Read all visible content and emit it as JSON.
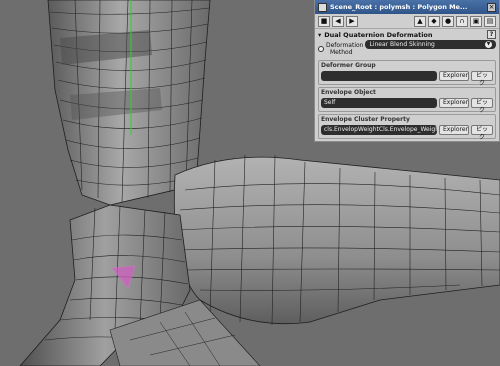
{
  "panel": {
    "title": "Scene_Root : polymsh : Polygon Me...",
    "close_glyph": "×",
    "toolbar": {
      "nav_prev": "◀",
      "nav_next": "▶"
    },
    "section": {
      "title": "Dual Quaternion Deformation",
      "help_label": "?",
      "collapse_glyph": "▾"
    },
    "deformation_method": {
      "label_line1": "Deformation",
      "label_line2": "Method",
      "value": "Linear Blend Skinning"
    },
    "deformer_group": {
      "label": "Deformer Group",
      "value": "",
      "explorer_label": "Explorer",
      "pick_label": "ピック"
    },
    "envelope_object": {
      "label": "Envelope Object",
      "value": "Self",
      "explorer_label": "Explorer",
      "pick_label": "ピック"
    },
    "envelope_cluster_property": {
      "label": "Envelope Cluster Property",
      "value": "cls.EnvelopWeightCls.Envelope_Weight",
      "explorer_label": "Explorer",
      "pick_label": "ピック"
    }
  },
  "colors": {
    "viewport_bg": "#6e6e6e",
    "mesh_fill": "#9a9a9a",
    "wire": "#1e1e1e",
    "titlebar": "#3d63a0",
    "selection": "#d060c0",
    "axis": "#2fd02f"
  }
}
